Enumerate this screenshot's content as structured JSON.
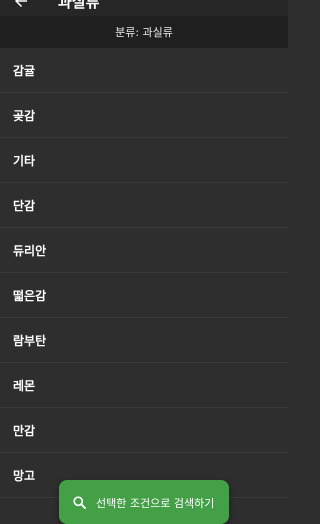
{
  "appbar": {
    "title": "과실류",
    "back_icon": "arrow-left-icon"
  },
  "subheader": {
    "text": "분류: 과실류"
  },
  "list": {
    "items": [
      {
        "label": "감귤"
      },
      {
        "label": "곶감"
      },
      {
        "label": "기타"
      },
      {
        "label": "단감"
      },
      {
        "label": "듀리안"
      },
      {
        "label": "떫은감"
      },
      {
        "label": "람부탄"
      },
      {
        "label": "레몬"
      },
      {
        "label": "만감"
      },
      {
        "label": "망고"
      }
    ]
  },
  "search_button": {
    "label": "선택한 조건으로 검색하기",
    "icon": "search-icon"
  },
  "colors": {
    "background": "#2e2e2e",
    "accent": "#43a047",
    "subheader": "#1f1f1f"
  }
}
